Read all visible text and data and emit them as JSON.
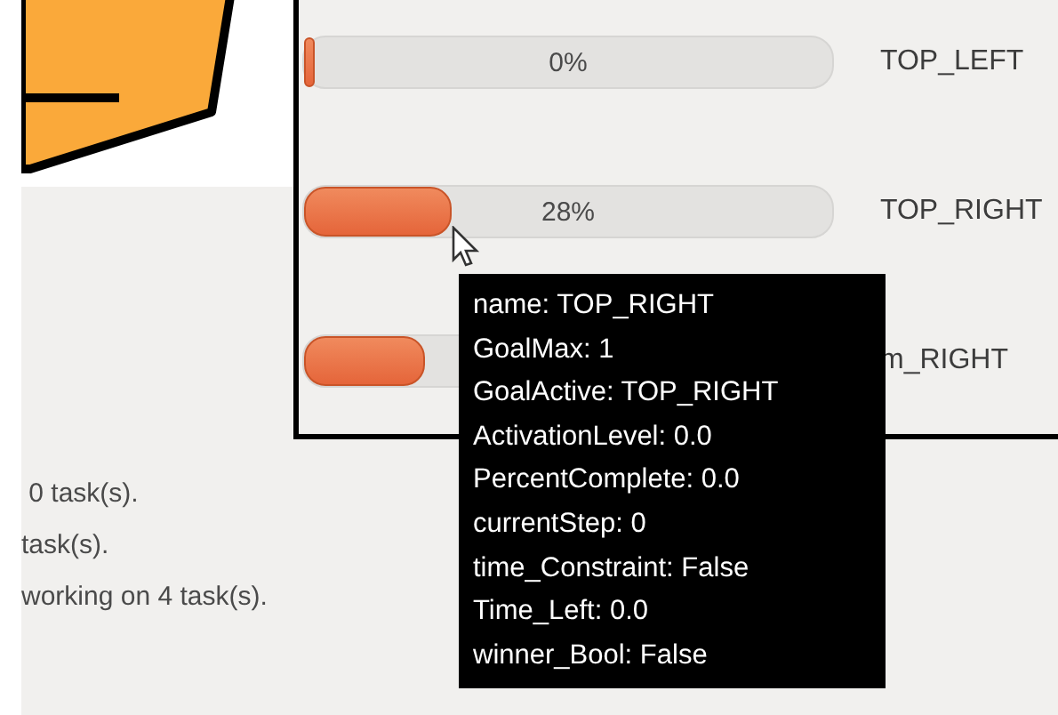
{
  "progress_rows": [
    {
      "percent": "0%",
      "level": 0,
      "label": "TOP_LEFT"
    },
    {
      "percent": "28%",
      "level": 0.28,
      "label": "TOP_RIGHT"
    },
    {
      "level": 0.23,
      "label": "m_RIGHT"
    }
  ],
  "tooltip": {
    "lines": [
      "name: TOP_RIGHT",
      "GoalMax: 1",
      "GoalActive: TOP_RIGHT",
      "ActivationLevel: 0.0",
      "PercentComplete: 0.0",
      "currentStep: 0",
      "time_Constraint: False",
      "Time_Left: 0.0",
      "winner_Bool: False"
    ]
  },
  "status_lines": [
    " 0 task(s).",
    "task(s).",
    "working on 4 task(s)."
  ]
}
